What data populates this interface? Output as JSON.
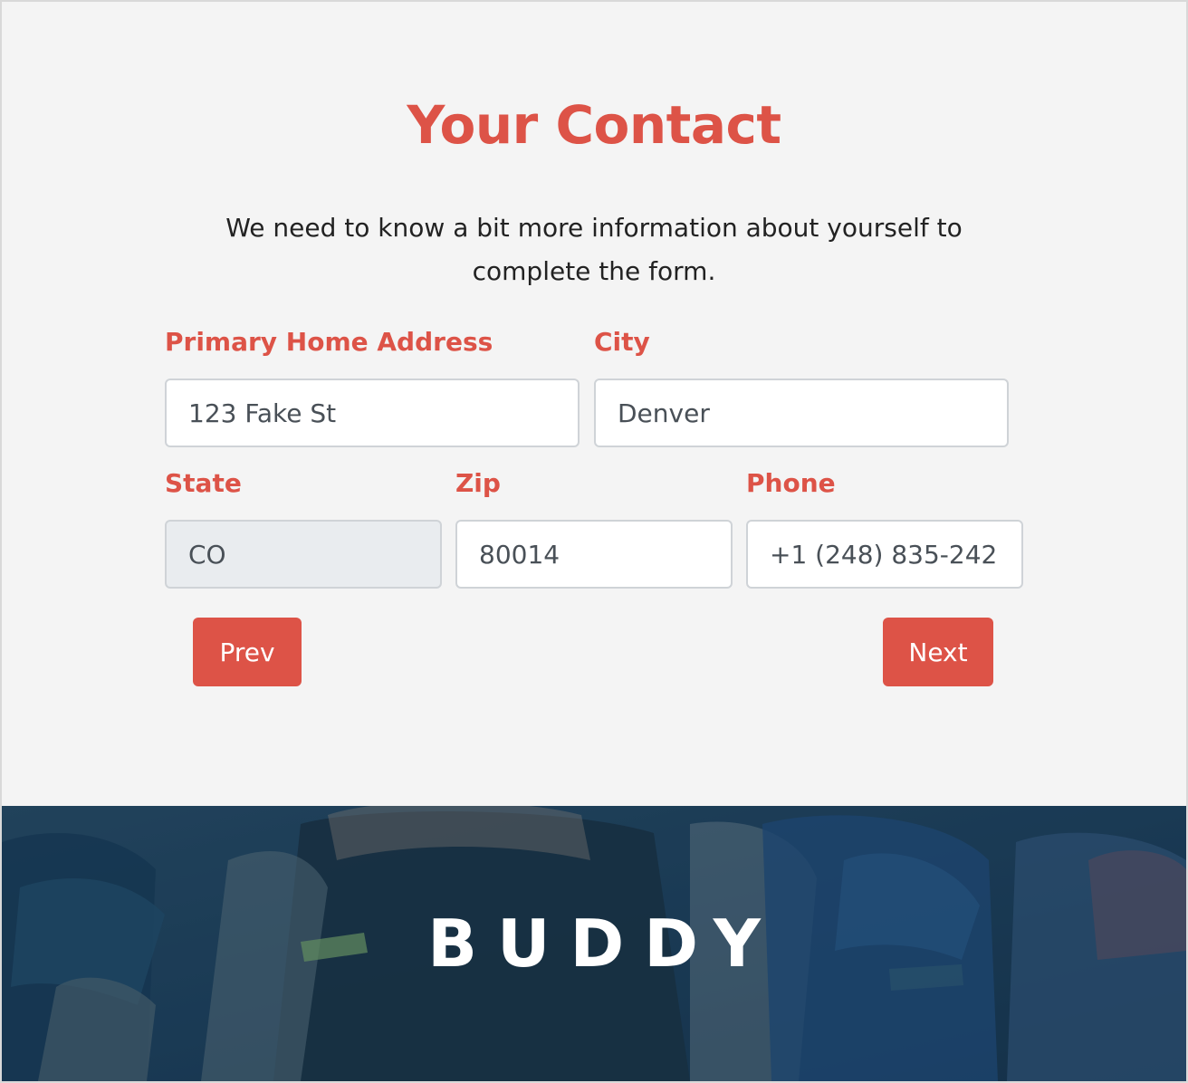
{
  "form": {
    "title": "Your Contact",
    "subtitle": "We need to know a bit more information about yourself to complete the form.",
    "fields": {
      "address": {
        "label": "Primary Home Address",
        "value": "123 Fake St"
      },
      "city": {
        "label": "City",
        "value": "Denver"
      },
      "state": {
        "label": "State",
        "value": "CO"
      },
      "zip": {
        "label": "Zip",
        "value": "80014"
      },
      "phone": {
        "label": "Phone",
        "value": "+1 (248) 835-242"
      }
    },
    "buttons": {
      "prev": "Prev",
      "next": "Next"
    }
  },
  "footer": {
    "brand": "BUDDY",
    "image_subject": "cyclists racing",
    "overlay_color": "#1e3d5a"
  },
  "colors": {
    "accent": "#dd5347",
    "background": "#f4f4f4",
    "input_border": "#cfd3d7",
    "readonly_bg": "#e9ecef"
  }
}
